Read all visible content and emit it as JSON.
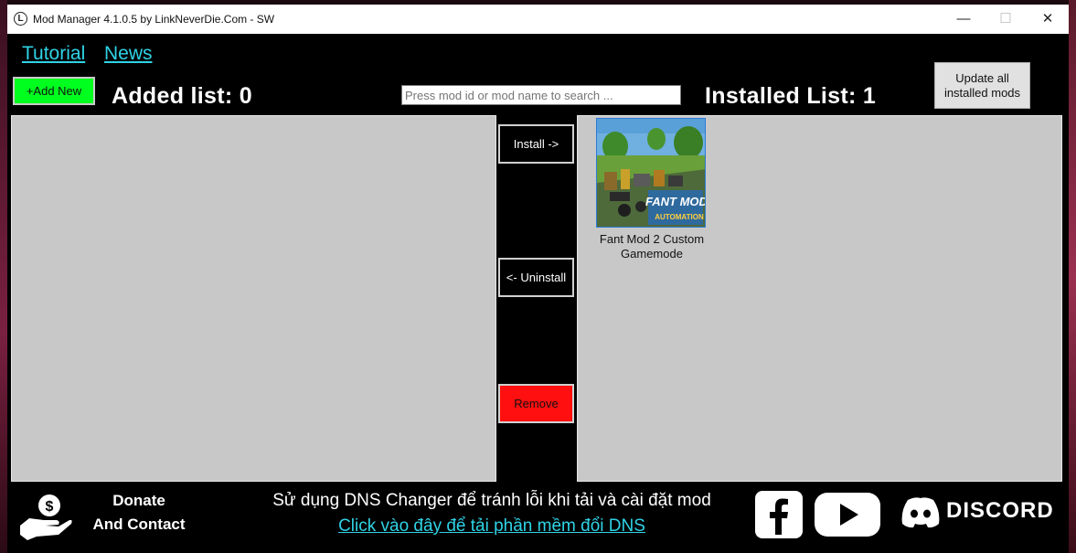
{
  "window": {
    "title": "Mod Manager 4.1.0.5 by LinkNeverDie.Com - SW",
    "app_icon_letter": "L",
    "controls": {
      "minimize": "—",
      "maximize": "☐",
      "close": "✕"
    }
  },
  "nav": {
    "tutorial": "Tutorial",
    "news": "News"
  },
  "toolbar": {
    "add_new": "+Add New",
    "added_list_label": "Added list:",
    "added_list_count": "0",
    "search_placeholder": "Press mod id or mod name to search ...",
    "installed_list_label": "Installed List:",
    "installed_list_count": "1",
    "update_all": "Update all installed mods"
  },
  "actions": {
    "install": "Install ->",
    "uninstall": "<- Uninstall",
    "remove": "Remove"
  },
  "installed_mods": [
    {
      "name": "Fant Mod 2 Custom Gamemode",
      "thumb_title": "FANT MOD",
      "thumb_subtitle": "AUTOMATION"
    }
  ],
  "footer": {
    "donate_line1": "Donate",
    "donate_line2": "And Contact",
    "dns_notice": "Sử dụng DNS Changer để tránh lỗi khi tải và cài đặt mod",
    "dns_link": "Click vào đây để tải phần mềm đổi DNS",
    "discord_label": "DISCORD"
  },
  "colors": {
    "accent_link": "#2fd3e6",
    "add_button": "#00ff1e",
    "remove_button": "#ff0f0f",
    "panel_bg": "#c8c8c8"
  },
  "icons": [
    "donate-hand-icon",
    "facebook-icon",
    "youtube-icon",
    "discord-icon"
  ]
}
